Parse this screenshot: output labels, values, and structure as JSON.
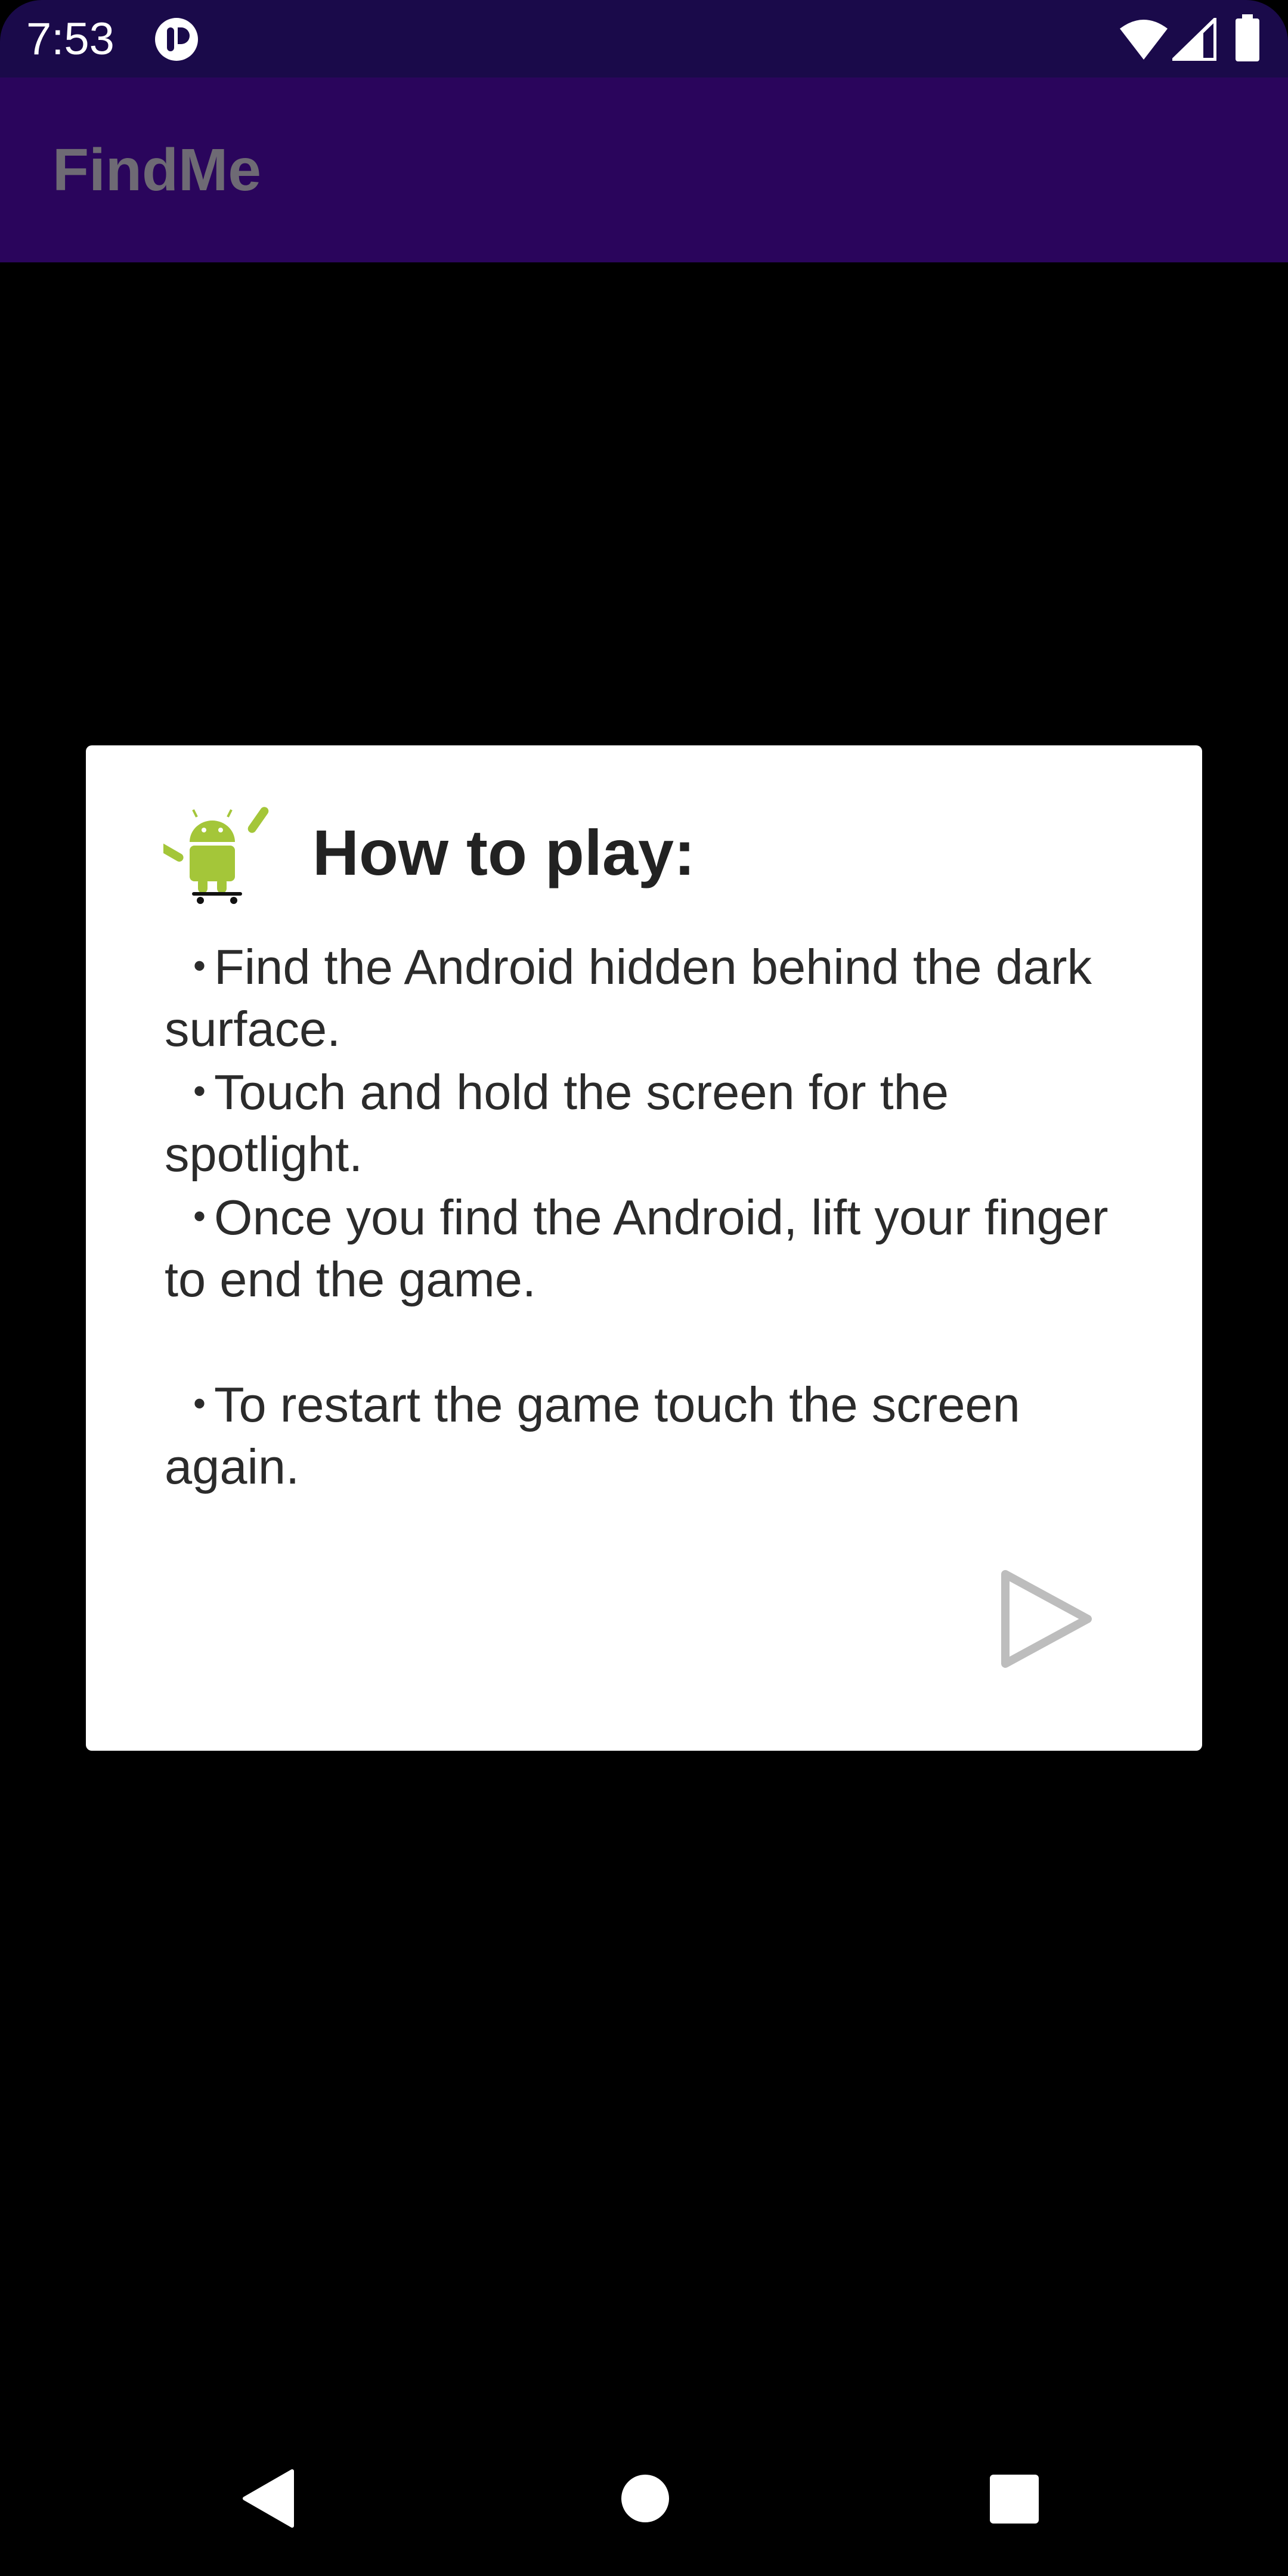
{
  "status_bar": {
    "time": "7:53",
    "app_icon": "app-notification-icon",
    "icons": [
      "wifi-icon",
      "cellular-signal-icon",
      "battery-icon"
    ]
  },
  "app_bar": {
    "title": "FindMe"
  },
  "dialog": {
    "icon": "android-skateboard-icon",
    "title": "How to play:",
    "instructions": [
      "Find the Android hidden behind the dark surface.",
      "Touch and hold the screen for the spotlight.",
      "Once you find the Android, lift your finger to end the game.",
      "To restart the game touch the screen again."
    ],
    "bullet": "•",
    "play_button_icon": "play-icon"
  },
  "nav_bar": {
    "icons": [
      "back-icon",
      "home-icon",
      "recents-icon"
    ]
  },
  "colors": {
    "status_bar": "#1a0a4a",
    "app_bar": "#2a055c",
    "app_title": "#6e6a74",
    "background": "#000000",
    "dialog": "#ffffff",
    "android_green": "#a4c639"
  }
}
